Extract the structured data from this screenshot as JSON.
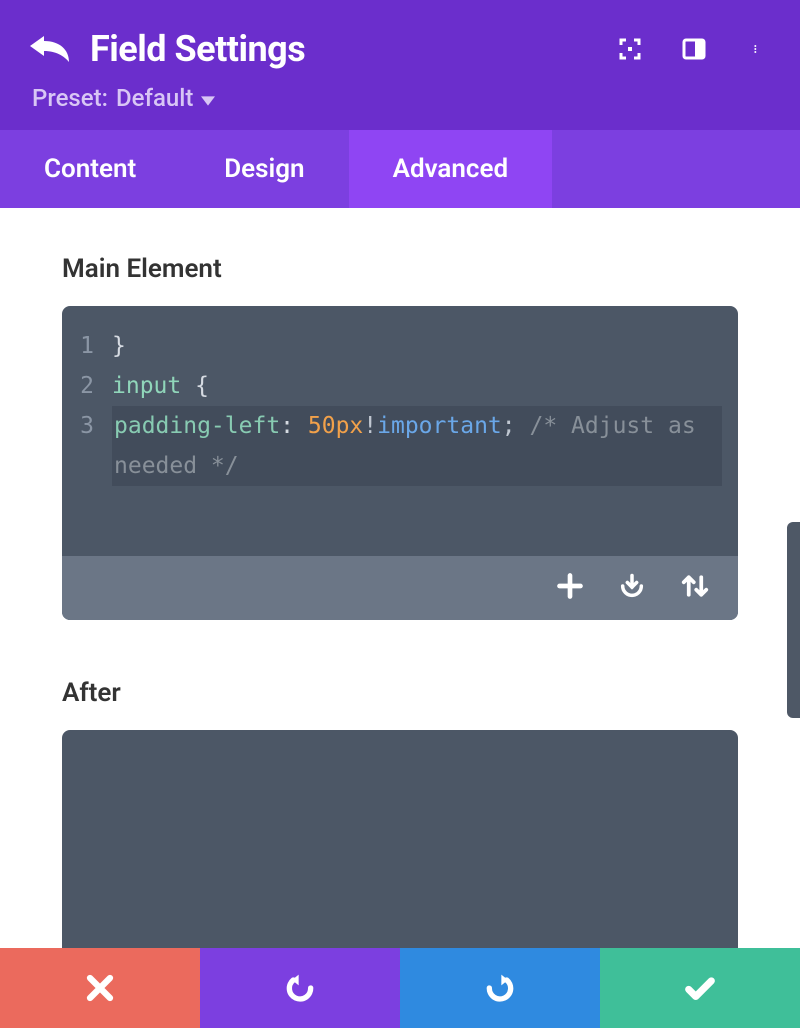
{
  "header": {
    "title": "Field Settings",
    "preset_label": "Preset:",
    "preset_value": "Default"
  },
  "tabs": {
    "content": "Content",
    "design": "Design",
    "advanced": "Advanced",
    "active": "advanced"
  },
  "sections": {
    "main_element": "Main Element",
    "after": "After"
  },
  "code": {
    "line1_num": "1",
    "line1_brace": "}",
    "line2_num": "2",
    "line2_selector": "input",
    "line2_brace": "{",
    "line3_num": "3",
    "line3_prop": "padding-left",
    "line3_value_num": "50px",
    "line3_value_bang": "!",
    "line3_value_important": "important",
    "line3_semicolon": ";",
    "line3_comment_open": "/*",
    "line3_comment_rest": "Adjust as needed */"
  }
}
